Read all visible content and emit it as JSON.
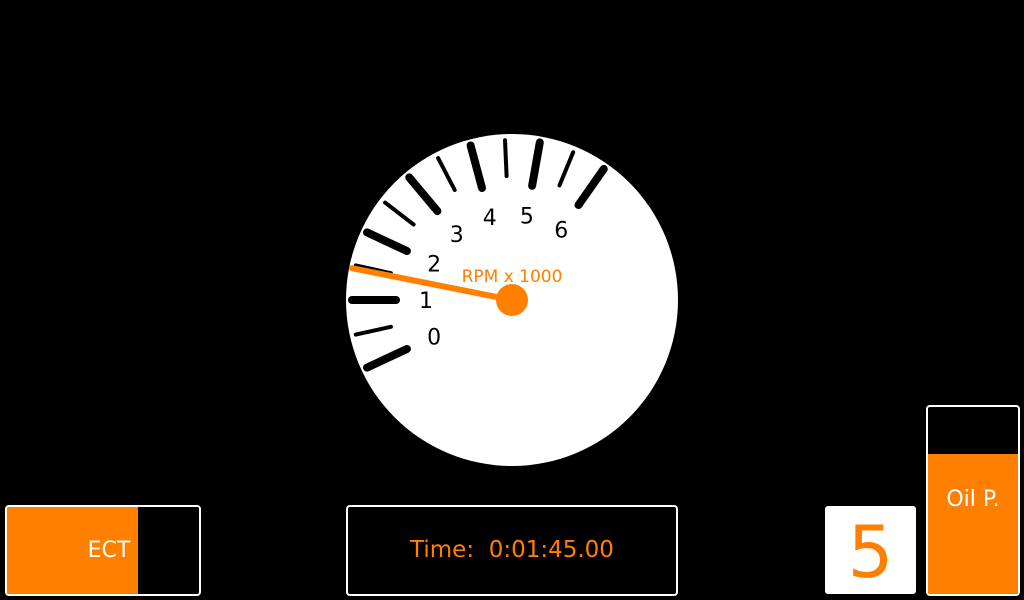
{
  "colors": {
    "background": "#000000",
    "accent": "#ff8000",
    "dial_face": "#ffffff",
    "tick": "#000000"
  },
  "tachometer": {
    "scale_labels": [
      "0",
      "1",
      "2",
      "3",
      "4",
      "5",
      "6"
    ],
    "unit_label": "RPM x 1000",
    "needle_rpm_thousands": 1.45
  },
  "ect": {
    "label": "ECT",
    "fill_fraction": 0.68
  },
  "timer": {
    "label": "Time:",
    "value": "0:01:45.00"
  },
  "gear": {
    "value": "5"
  },
  "oil_pressure": {
    "label": "Oil P.",
    "fill_fraction": 0.75
  }
}
